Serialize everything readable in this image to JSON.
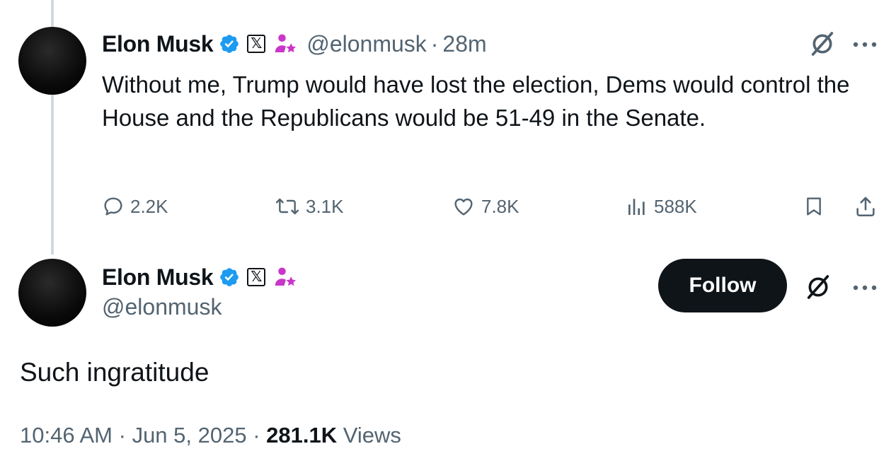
{
  "quoted_tweet": {
    "author_name": "Elon Musk",
    "handle": "@elonmusk",
    "separator": "·",
    "time": "28m",
    "text": "Without me, Trump would have lost the election, Dems would control the House and the Republicans would be 51-49 in the Senate.",
    "actions": {
      "replies": "2.2K",
      "reposts": "3.1K",
      "likes": "7.8K",
      "views": "588K"
    },
    "icons": [
      "verified-badge-icon",
      "x-affiliation-icon",
      "affiliate-person-icon",
      "grok-icon",
      "more-icon",
      "reply-icon",
      "repost-icon",
      "like-icon",
      "views-icon",
      "bookmark-icon",
      "share-icon"
    ]
  },
  "main_tweet": {
    "author_name": "Elon Musk",
    "handle": "@elonmusk",
    "follow_label": "Follow",
    "text": "Such ingratitude",
    "time": "10:46 AM",
    "separator_1": "·",
    "date": "Jun 5, 2025",
    "separator_2": "·",
    "views_count": "281.1K",
    "views_label": "Views"
  },
  "colors": {
    "text_primary": "#0f1419",
    "text_secondary": "#536471",
    "verified_blue": "#1d9bf0",
    "affiliate_pink": "#c936c9",
    "follow_bg": "#0f1419",
    "thread_line": "#cfd9de"
  }
}
